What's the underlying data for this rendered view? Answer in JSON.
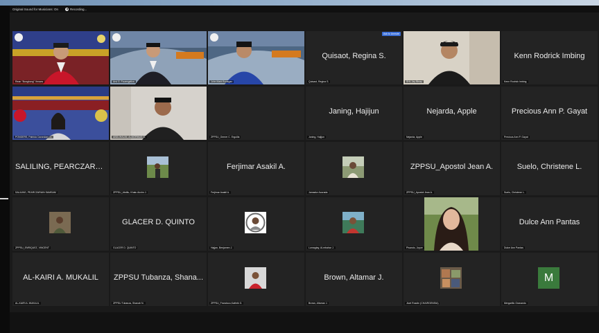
{
  "topbar": {
    "audio_label": "Original Sound for Musicians: On",
    "recording_label": "Recording..."
  },
  "tiles": [
    {
      "caption": "Rean \"Bongbong\" Vences"
    },
    {
      "caption": "Arvi G. Fauengaliza"
    },
    {
      "caption": "John Mark Bunagan"
    },
    {
      "big": "Quisaot, Regina S.",
      "caption": "Quisaot, Regina S.",
      "badge": "Ask to Unmute"
    },
    {
      "caption": "SHL Jay Binay"
    },
    {
      "big": "Kenn Rodrick Imbing",
      "caption": "Kenn Rodrick Imbing"
    },
    {
      "caption": "PONDERS, Patricia Carandam G."
    },
    {
      "caption": "ABDUHALIM, ALMORMUS G."
    },
    {
      "caption": "ZPPSU_Gemer C. Erguilla"
    },
    {
      "big": "Janing, Hajijun",
      "caption": "Janing, Hajijun"
    },
    {
      "big": "Nejarda, Apple",
      "caption": "Nejarda, Apple"
    },
    {
      "big": "Precious Ann P. Gayat",
      "caption": "Precious Ann P. Gayat"
    },
    {
      "big": "SALILING, PEARCZARA...",
      "caption": "SALILING, PEARCZARAIN SAMSAM"
    },
    {
      "caption": "ZPPSU_Abdilu, Khalu Aicrim J."
    },
    {
      "big": "Ferjimar Asakil A.",
      "caption": "Ferjimar Asakil A."
    },
    {
      "caption": "Jamadur Acurada"
    },
    {
      "big": "ZPPSU_Apostol Jean A.",
      "caption": "ZPPSU_Apostol Jean A."
    },
    {
      "big": "Suelo, Christene L.",
      "caption": "Suelo, Christene L."
    },
    {
      "caption": "ZPPSU_ENRIQUEZ, VINCENT"
    },
    {
      "big": "GLACER D. QUINTO",
      "caption": "GLACER D. QUINTO"
    },
    {
      "caption": "Hajjan, Benjamen J."
    },
    {
      "caption": "Lumagtay, Al-mbahar J."
    },
    {
      "caption": "Pisando, Joyce"
    },
    {
      "big": "Dulce Ann Pantas",
      "caption": "Dulce Ann Pantas"
    },
    {
      "big": "AL-KAIRI A. MUKALIL",
      "caption": "AL-KAIRI A. MUKALIL"
    },
    {
      "big": "ZPPSU Tubanza, Shana...",
      "caption": "ZPPSU Tubanza, Shanah N."
    },
    {
      "caption": "ZPPSU_Francisco,Kathrik G."
    },
    {
      "big": "Brown, Altamar J.",
      "caption": "Brown, Altamar J."
    },
    {
      "caption": "Jiuel Rosdin (CHAIRGENSIA)"
    },
    {
      "avatar_letter": "M",
      "caption": "Mergarillo Granando"
    }
  ],
  "colors": {
    "tile_bg": "#232323",
    "active_speaker": "#2ecc5a",
    "avatar_m": "#3a7a3c"
  }
}
